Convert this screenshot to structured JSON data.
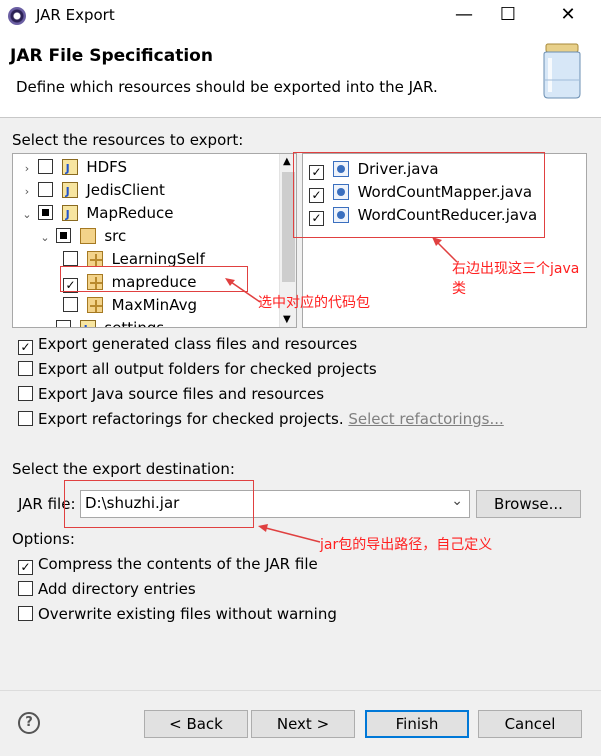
{
  "window": {
    "title": "JAR Export"
  },
  "header": {
    "title": "JAR File Specification",
    "description": "Define which resources should be exported into the JAR."
  },
  "resources": {
    "label": "Select the resources to export:",
    "tree": [
      {
        "label": "HDFS",
        "checked": false
      },
      {
        "label": "JedisClient",
        "checked": false
      },
      {
        "label": "MapReduce",
        "checked": "partial"
      },
      {
        "label": "src",
        "checked": "partial"
      },
      {
        "label": "LearningSelf",
        "checked": false
      },
      {
        "label": "mapreduce",
        "checked": true
      },
      {
        "label": "MaxMinAvg",
        "checked": false
      },
      {
        "label": "settings",
        "checked": false
      }
    ],
    "files": [
      {
        "label": "Driver.java",
        "checked": true
      },
      {
        "label": "WordCountMapper.java",
        "checked": true
      },
      {
        "label": "WordCountReducer.java",
        "checked": true
      }
    ]
  },
  "export_options": [
    {
      "label": "Export generated class files and resources",
      "checked": true
    },
    {
      "label": "Export all output folders for checked projects",
      "checked": false
    },
    {
      "label": "Export Java source files and resources",
      "checked": false
    },
    {
      "label": "Export refactorings for checked projects.",
      "checked": false
    }
  ],
  "select_refactorings_link": "Select refactorings...",
  "destination": {
    "label": "Select the export destination:",
    "jar_file_label": "JAR file:",
    "jar_file_value": "D:\\shuzhi.jar",
    "browse_label": "Browse..."
  },
  "options": {
    "label": "Options:",
    "items": [
      {
        "label": "Compress the contents of the JAR file",
        "checked": true
      },
      {
        "label": "Add directory entries",
        "checked": false
      },
      {
        "label": "Overwrite existing files without warning",
        "checked": false
      }
    ]
  },
  "buttons": {
    "back": "< Back",
    "next": "Next >",
    "finish": "Finish",
    "cancel": "Cancel"
  },
  "annotations": {
    "select_package": "选中对应的代码包",
    "classes_line1": "右边出现这三个java",
    "classes_line2": "类",
    "jar_path": "jar包的导出路径，自己定义"
  },
  "colors": {
    "annotation": "#ff2020",
    "default_button_border": "#0078d7"
  }
}
